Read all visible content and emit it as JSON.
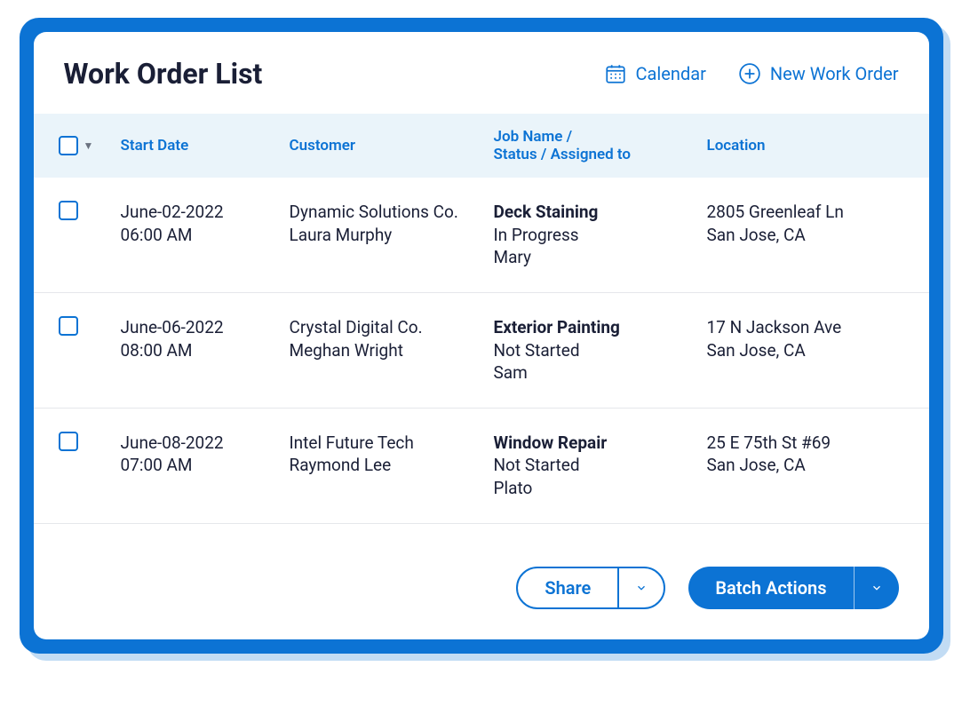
{
  "header": {
    "title": "Work Order List",
    "calendar_label": "Calendar",
    "new_label": "New Work Order"
  },
  "columns": {
    "start_date": "Start Date",
    "customer": "Customer",
    "job_line1": "Job Name /",
    "job_line2": "Status / Assigned to",
    "location": "Location"
  },
  "rows": [
    {
      "date": "June-02-2022",
      "time": "06:00 AM",
      "company": "Dynamic Solutions Co.",
      "contact": "Laura Murphy",
      "job": "Deck Staining",
      "status": "In Progress",
      "assigned": "Mary",
      "addr1": "2805 Greenleaf Ln",
      "addr2": "San Jose, CA"
    },
    {
      "date": "June-06-2022",
      "time": "08:00 AM",
      "company": "Crystal Digital Co.",
      "contact": "Meghan Wright",
      "job": "Exterior Painting",
      "status": "Not Started",
      "assigned": "Sam",
      "addr1": "17 N Jackson Ave",
      "addr2": "San Jose, CA"
    },
    {
      "date": "June-08-2022",
      "time": "07:00 AM",
      "company": "Intel Future Tech",
      "contact": "Raymond Lee",
      "job": "Window Repair",
      "status": "Not Started",
      "assigned": "Plato",
      "addr1": "25 E 75th St #69",
      "addr2": "San Jose, CA"
    }
  ],
  "footer": {
    "share_label": "Share",
    "batch_label": "Batch Actions"
  }
}
